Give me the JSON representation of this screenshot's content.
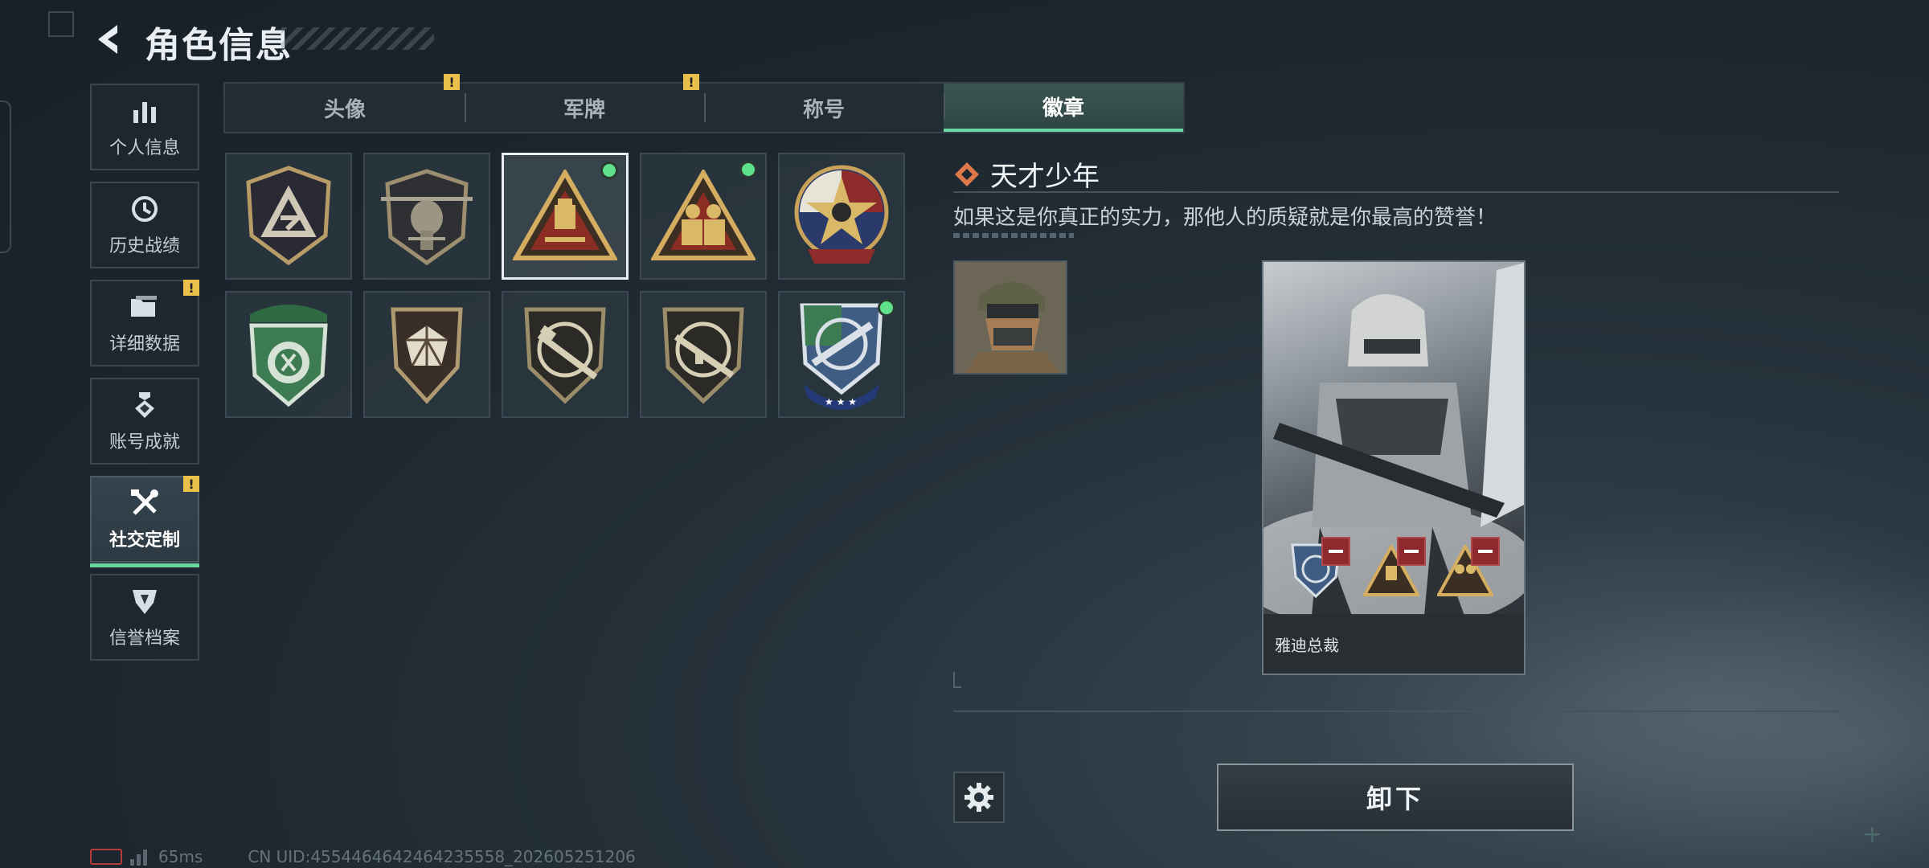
{
  "header": {
    "title": "角色信息"
  },
  "sidebar": {
    "items": [
      {
        "label": "个人信息",
        "icon": "bar-chart-icon",
        "alert": false,
        "active": false
      },
      {
        "label": "历史战绩",
        "icon": "history-clock-icon",
        "alert": false,
        "active": false
      },
      {
        "label": "详细数据",
        "icon": "folder-icon",
        "alert": true,
        "active": false
      },
      {
        "label": "账号成就",
        "icon": "achievement-medal-icon",
        "alert": false,
        "active": false
      },
      {
        "label": "社交定制",
        "icon": "tools-icon",
        "alert": true,
        "active": true
      },
      {
        "label": "信誉档案",
        "icon": "reputation-shield-icon",
        "alert": false,
        "active": false
      }
    ],
    "alert_mark": "!"
  },
  "tabs": [
    {
      "label": "头像",
      "alert": true,
      "active": false
    },
    {
      "label": "军牌",
      "alert": true,
      "active": false
    },
    {
      "label": "称号",
      "alert": false,
      "active": false
    },
    {
      "label": "徽章",
      "alert": false,
      "active": true
    }
  ],
  "badges": [
    {
      "icon": "triangle-shield-badge-icon",
      "new": false,
      "selected": false
    },
    {
      "icon": "helicopter-badge-icon",
      "new": false,
      "selected": false
    },
    {
      "icon": "genius-triangle-badge-icon",
      "new": true,
      "selected": true
    },
    {
      "icon": "squad-triangle-badge-icon",
      "new": true,
      "selected": false
    },
    {
      "icon": "star-round-badge-icon",
      "new": false,
      "selected": false
    },
    {
      "icon": "green-shield-badge-icon",
      "new": false,
      "selected": false
    },
    {
      "icon": "gem-shield-badge-icon",
      "new": false,
      "selected": false
    },
    {
      "icon": "rifle-shield-badge-icon",
      "new": false,
      "selected": false
    },
    {
      "icon": "rifle-shield-badge-2-icon",
      "new": false,
      "selected": false
    },
    {
      "icon": "blue-knife-badge-icon",
      "new": true,
      "selected": false
    }
  ],
  "detail": {
    "name": "天才少年",
    "description": "如果这是你真正的实力，那他人的质疑就是你最高的赞誉！",
    "preview_name": "雅迪总裁",
    "unequip_label": "卸下"
  },
  "footer": {
    "ping": "65ms",
    "uid": "CN UID:4554464642464235558_202605251206"
  },
  "colors": {
    "accent_green": "#6ad7a0",
    "alert_yellow": "#e9c14a",
    "new_dot": "#5fe08b",
    "remove_red": "#8c2a2e"
  }
}
